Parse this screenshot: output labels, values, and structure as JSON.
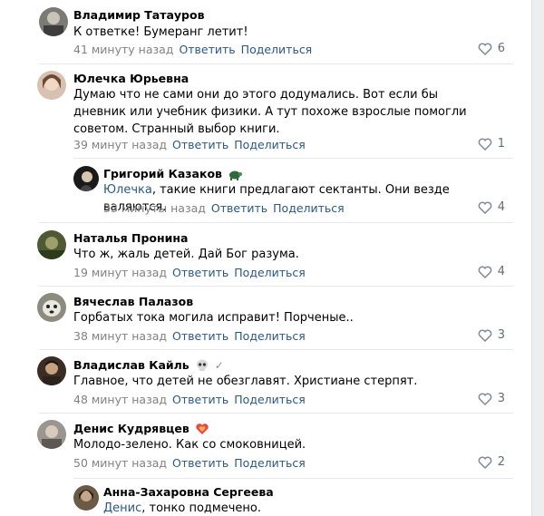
{
  "actions": {
    "reply": "Ответить",
    "share": "Поделиться"
  },
  "comments": [
    {
      "author": "Владимир Татауров",
      "text": "К ответке! Бумеранг летит!",
      "time": "41 минуту назад",
      "likes": "6"
    },
    {
      "author": "Юлечка Юрьевна",
      "text": "Думаю что не сами они до этого додумались. Вот если бы дневник или учебник физики. А тут похоже взрослые помогли советом. Странный выбор книги.",
      "time": "39 минут назад",
      "likes": "1"
    },
    {
      "author": "Григорий Казаков",
      "reply_to": "Юлечка",
      "text": ", такие книги предлагают сектанты. Они везде валяются.",
      "time": "33 минуты назад",
      "likes": "4"
    },
    {
      "author": "Наталья Пронина",
      "text": "Что ж, жаль детей. Дай Бог разума.",
      "time": "19 минут назад",
      "likes": "4"
    },
    {
      "author": "Вячеслав Палазов",
      "text": "Горбатых тока могила исправит! Порченые..",
      "time": "38 минут назад",
      "likes": "3"
    },
    {
      "author": "Владислав Кайль",
      "text": "Главное, что детей не обезглавят. Христиане стерпят.",
      "time": "48 минут назад",
      "likes": "3"
    },
    {
      "author": "Денис Кудрявцев",
      "text": "Молодо-зелено. Как со смоковницей.",
      "time": "50 минут назад",
      "likes": "2"
    },
    {
      "author": "Анна-Захаровна Сергеева",
      "reply_to": "Денис",
      "text": ", тонко подмечено.",
      "time": "",
      "likes": ""
    }
  ]
}
